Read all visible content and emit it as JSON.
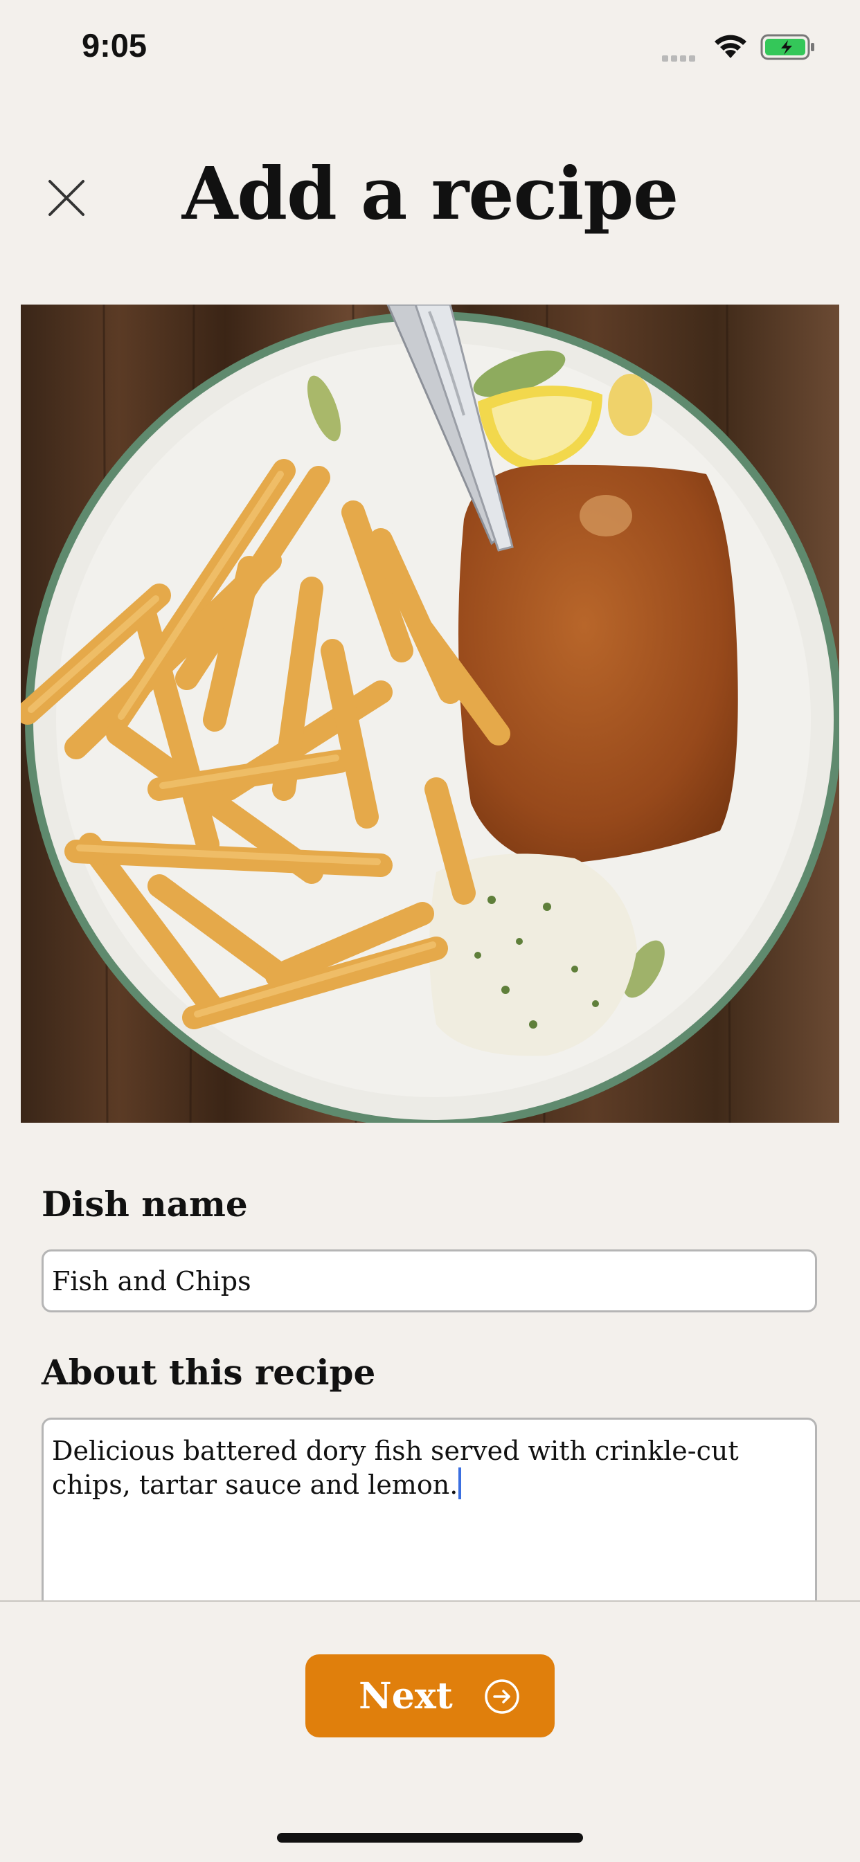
{
  "status_bar": {
    "time": "9:05"
  },
  "header": {
    "title": "Add a recipe"
  },
  "form": {
    "dish_label": "Dish name",
    "dish_value": "Fish and Chips",
    "about_label": "About this recipe",
    "about_value": "Delicious battered dory fish served with crinkle-cut chips, tartar sauce and lemon."
  },
  "footer": {
    "next_label": "Next"
  },
  "colors": {
    "accent": "#e07f0c",
    "background": "#f3f0ec",
    "caret": "#3b6fe0",
    "battery_fill": "#34c759"
  },
  "icons": [
    "close-icon",
    "wifi-icon",
    "battery-icon",
    "arrow-right-circle-icon"
  ]
}
